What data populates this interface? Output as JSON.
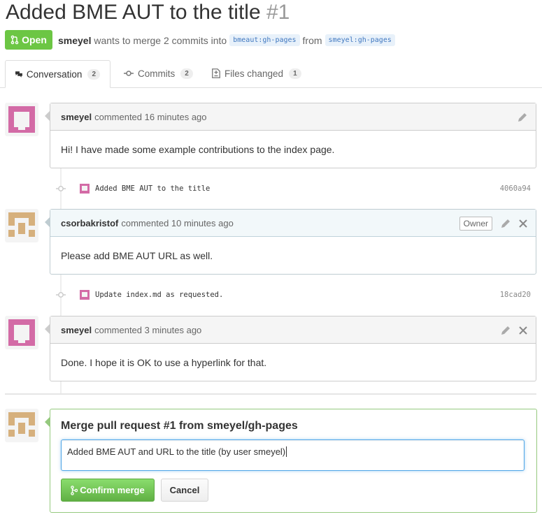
{
  "pr": {
    "title": "Added BME AUT to the title",
    "number": "#1",
    "state": "Open",
    "author": "smeyel",
    "meta_text": "wants to merge 2 commits into",
    "base_branch": "bmeaut:gh-pages",
    "from_text": "from",
    "head_branch": "smeyel:gh-pages"
  },
  "tabs": [
    {
      "label": "Conversation",
      "count": "2"
    },
    {
      "label": "Commits",
      "count": "2"
    },
    {
      "label": "Files changed",
      "count": "1"
    }
  ],
  "comments": [
    {
      "author": "smeyel",
      "meta": "commented 16 minutes ago",
      "body": "Hi! I have made some example contributions to the index page."
    },
    {
      "author": "csorbakristof",
      "meta": "commented 10 minutes ago",
      "badge": "Owner",
      "body": "Please add BME AUT URL as well."
    },
    {
      "author": "smeyel",
      "meta": "commented 3 minutes ago",
      "body": "Done. I hope it is OK to use a hyperlink for that."
    }
  ],
  "commits": [
    {
      "message": "Added BME AUT to the title",
      "sha": "4060a94"
    },
    {
      "message": "Update index.md as requested.",
      "sha": "18cad20"
    }
  ],
  "merge": {
    "title": "Merge pull request #1 from smeyel/gh-pages",
    "input_value": "Added BME AUT and URL to the title (by user smeyel)",
    "confirm_label": "Confirm merge",
    "cancel_label": "Cancel"
  },
  "colors": {
    "open_green": "#6cc644",
    "smeyel_avatar": "#d36ba6",
    "csorba_avatar": "#d6b07d"
  },
  "icons": [
    "pr-icon",
    "conversation-icon",
    "commit-icon",
    "file-diff-icon",
    "pencil-icon",
    "close-icon",
    "merge-icon"
  ]
}
